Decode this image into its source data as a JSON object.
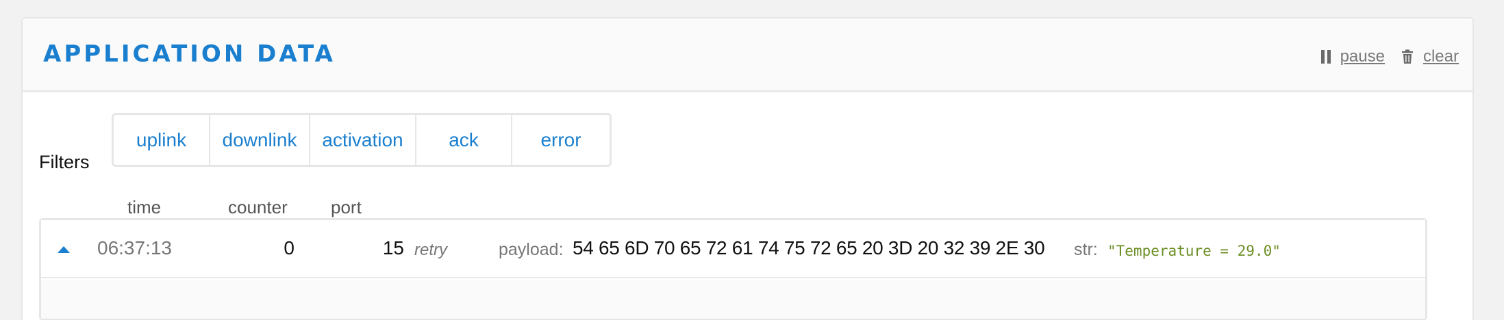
{
  "header": {
    "title": "APPLICATION DATA",
    "pause_label": "pause",
    "clear_label": "clear"
  },
  "filters": {
    "label": "Filters",
    "buttons": [
      "uplink",
      "downlink",
      "activation",
      "ack",
      "error"
    ]
  },
  "table": {
    "columns": {
      "time": "time",
      "counter": "counter",
      "port": "port"
    },
    "rows": [
      {
        "time": "06:37:13",
        "counter": "0",
        "port": "15",
        "flag": "retry",
        "payload_label": "payload:",
        "payload": "54 65 6D 70 65 72 61 74 75 72 65 20 3D 20 32 39 2E 30",
        "str_label": "str:",
        "str": "\"Temperature = 29.0\""
      }
    ]
  },
  "colors": {
    "accent": "#1a7fcf",
    "string_value": "#6b8e23",
    "muted_text": "#777777"
  },
  "icons": [
    "pause-icon",
    "trash-icon",
    "caret-up-icon"
  ]
}
